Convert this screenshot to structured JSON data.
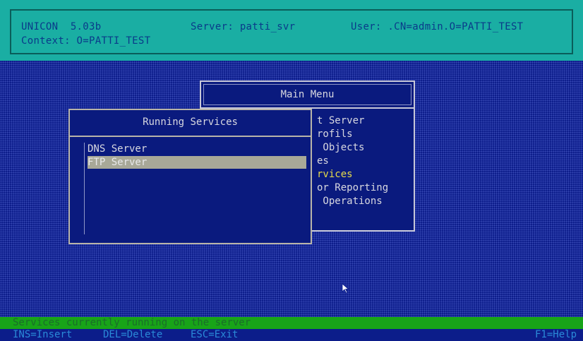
{
  "header": {
    "app": "UNICON  5.03b",
    "server": "Server: patti_svr",
    "user": "User: .CN=admin.O=PATTI_TEST",
    "context": "Context: O=PATTI_TEST"
  },
  "main_menu": {
    "title": "Main Menu",
    "items": [
      {
        "label": "t Server"
      },
      {
        "label": "rofils"
      },
      {
        "label": " Objects"
      },
      {
        "label": "es"
      },
      {
        "label": "rvices"
      },
      {
        "label": "or Reporting"
      },
      {
        "label": " Operations"
      }
    ]
  },
  "running_services": {
    "title": "Running Services",
    "items": [
      {
        "label": "DNS Server",
        "selected": false
      },
      {
        "label": "FTP Server",
        "selected": true
      }
    ]
  },
  "status": {
    "message": "Services currently running on the server",
    "key_insert": "INS=Insert",
    "key_delete": "DEL=Delete",
    "key_exit": "ESC=Exit",
    "key_help": "F1=Help"
  },
  "colors": {
    "background": "#0c1d8a",
    "header": "#1aaea3",
    "status_bar": "#18a418",
    "selection": "#a8a898",
    "highlight_text": "#e8dc4a"
  }
}
